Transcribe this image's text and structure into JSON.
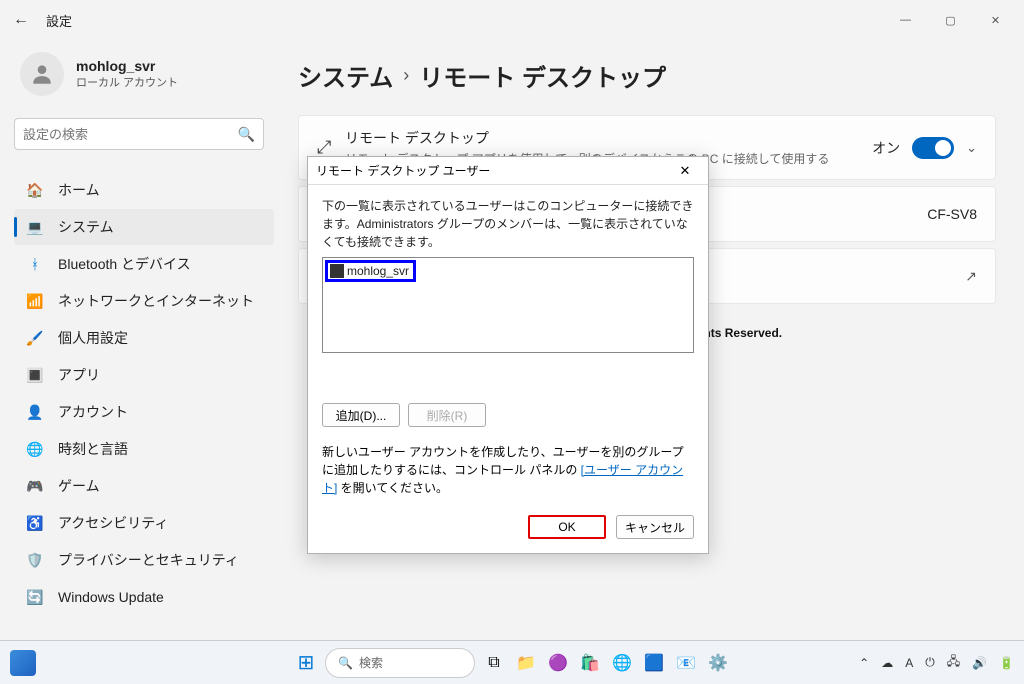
{
  "window": {
    "title": "設定",
    "min": "—",
    "max": "▢",
    "close": "✕"
  },
  "user": {
    "name": "mohlog_svr",
    "acct": "ローカル アカウント"
  },
  "search": {
    "placeholder": "設定の検索"
  },
  "nav": {
    "items": [
      {
        "label": "ホーム"
      },
      {
        "label": "システム"
      },
      {
        "label": "Bluetooth とデバイス"
      },
      {
        "label": "ネットワークとインターネット"
      },
      {
        "label": "個人用設定"
      },
      {
        "label": "アプリ"
      },
      {
        "label": "アカウント"
      },
      {
        "label": "時刻と言語"
      },
      {
        "label": "ゲーム"
      },
      {
        "label": "アクセシビリティ"
      },
      {
        "label": "プライバシーとセキュリティ"
      },
      {
        "label": "Windows Update"
      }
    ]
  },
  "breadcrumb": {
    "a": "システム",
    "sep": "›",
    "b": "リモート デスクトップ"
  },
  "card1": {
    "title": "リモート デスクトップ",
    "sub": "リモート デスクトップ アプリを使用して、別のデバイスからこの PC に接続して使用する",
    "state": "オン"
  },
  "card2": {
    "value": "CF-SV8"
  },
  "dialog": {
    "title": "リモート デスクトップ ユーザー",
    "msg": "下の一覧に表示されているユーザーはこのコンピューターに接続できます。Administrators グループのメンバーは、一覧に表示されていなくても接続できます。",
    "user": "mohlog_svr",
    "add": "追加(D)...",
    "remove": "削除(R)",
    "foot1": "新しいユーザー アカウントを作成したり、ユーザーを別のグループに追加したりするには、コントロール パネルの ",
    "link": "[ユーザー アカウント]",
    "foot2": " を開いてください。",
    "ok": "OK",
    "cancel": "キャンセル"
  },
  "copyright": "Copyright © 2024 もーろぐ All Rights Reserved.",
  "taskbar": {
    "search": "検索",
    "ime": "A"
  }
}
